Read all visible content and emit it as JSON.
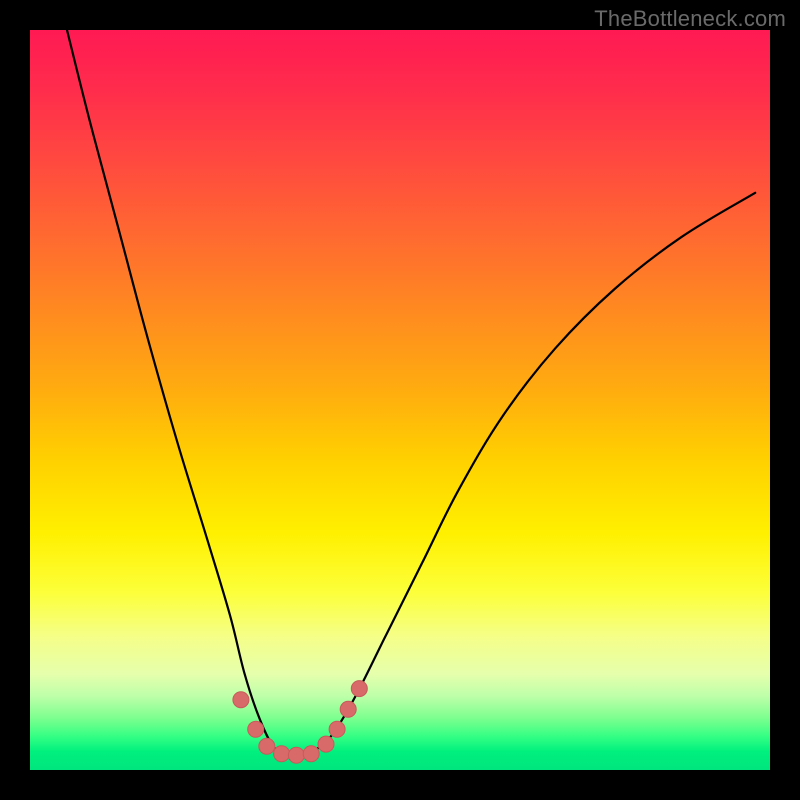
{
  "watermark": "TheBottleneck.com",
  "colors": {
    "frame": "#000000",
    "curve_stroke": "#000000",
    "marker_fill": "#d86a6a",
    "marker_stroke": "#c75a5a",
    "gradient_top": "#ff1a53",
    "gradient_bottom": "#00e57e"
  },
  "chart_data": {
    "type": "line",
    "title": "",
    "xlabel": "",
    "ylabel": "",
    "xlim": [
      0,
      100
    ],
    "ylim": [
      0,
      100
    ],
    "note": "V-shaped bottleneck curve; minimum plateau near x≈33–38 at y≈2. Axis values are estimated from pixel positions (no tick labels are rendered).",
    "series": [
      {
        "name": "bottleneck-curve",
        "x": [
          5,
          8,
          12,
          16,
          20,
          24,
          27,
          29,
          31,
          33,
          35,
          37,
          39,
          41,
          44,
          48,
          53,
          58,
          64,
          71,
          79,
          88,
          98
        ],
        "y": [
          100,
          88,
          73,
          58,
          44,
          31,
          21,
          13,
          7,
          3,
          2,
          2,
          3,
          5,
          10,
          18,
          28,
          38,
          48,
          57,
          65,
          72,
          78
        ]
      }
    ],
    "markers": {
      "name": "highlight-points",
      "x": [
        28.5,
        30.5,
        32,
        34,
        36,
        38,
        40,
        41.5,
        43,
        44.5
      ],
      "y": [
        9.5,
        5.5,
        3.2,
        2.2,
        2.0,
        2.2,
        3.5,
        5.5,
        8.2,
        11.0
      ]
    }
  }
}
